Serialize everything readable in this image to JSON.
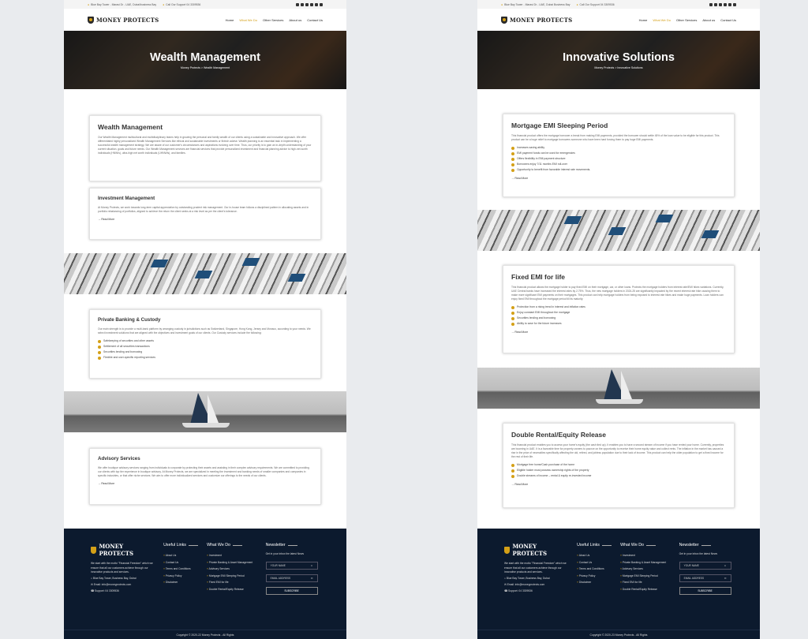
{
  "topbar": {
    "address": "Blue Bay Tower - Marasi Dr - UAE, Dubai/business Bay",
    "phone": "Call Our Support 04 3309536",
    "address_right": "Blue Bay Tower - Marasi Dr - UAE, Dubai Business Bay"
  },
  "brand": "MONEY PROTECTS",
  "nav": [
    "Home",
    "What We Do",
    "Other Services",
    "About us",
    "Contact Us"
  ],
  "left": {
    "hero_title": "Wealth Management",
    "breadcrumb": "Money Protects > Wealth Management",
    "cards": [
      {
        "title": "Wealth Management",
        "body": "Our Wealth Management multicultural and multidisciplinary teams help in growing the personal and family wealth of our clients using a sustainable and innovative approach. We offer differentiated highly personalized Wealth Management Services like ethical and sustainable investments or fintech advise. Wealth planning is an essential task in implementing a successful wealth management strategy. We are aware of our customer's circumstances and aspirations evolving over time. Thus, our priority is to gain an in-depth understanding of your current situation, goals and future needs. Our Wealth Management services are financial services that provide personalized investment and financial planning advice to high-net-worth individuals (HNWIs), ultra-high net worth individuals (UHNWIs), and families."
      },
      {
        "title": "Investment Management",
        "body": "At Money Protects, we work towards long-term capital appreciation by outstanding prudent risk management. Our in-house team follows a disciplined pattern in allocating assets and in portfolio rebalancing of portfolios, aligned to achieve the return the client seeks at a risk level as per the client's tolerance.",
        "readmore": "Read More"
      },
      {
        "title": "Private Banking & Custody",
        "body": "Our main strength is to provide a multi-bank platform by arranging custody in jurisdictions such as Switzerland, Singapore, Hong Kong, Jersey and Monaco, according to your needs. We select investment solutions that are aligned with the objectives and investment goals of our clients. Our Custody services include the following:",
        "items": [
          "Safekeeping of securities and other assets",
          "Settlement of all securities transactions",
          "Securities lending and borrowing",
          "Flexible and user-specific reporting services"
        ]
      },
      {
        "title": "Advisory Services",
        "body": "We offer boutique advisory services ranging from individuals to corporate by protecting their assets and assisting in their complex advisory requirements. We are committed to providing our clients with top tier experience in boutique advisory. At Money Protects, we are specialized in meeting the investment and banking needs of smaller companies and companies in specific industries, or that offer niche services. We aim to offer more individualized services and customize our offerings to the needs of our clients.",
        "readmore": "Read More"
      }
    ]
  },
  "right": {
    "hero_title": "Innovative Solutions",
    "breadcrumb": "Money Protects > Innovative Solutions",
    "cards": [
      {
        "title": "Mortgage EMI Sleeping Period",
        "body": "This financial product offers the mortgage borrower a break from making EMI payments, provided the borrower should settle 45% of the loan value to be eligible for this product. This product can be a huge relief to mortgage borrowers someone who have been hard forcing them to pay huge EMI payments.",
        "items": [
          "Increases saving ability",
          "EMI payment funds can be used for emergencies",
          "Offers flexibility in EMI payment structure",
          "Borrowers enjoy 7/11 months EMI roll-over",
          "Opportunity to benefit from favorable interest rate movements."
        ],
        "readmore": "Read More"
      },
      {
        "title": "Fixed EMI for life",
        "body": "This financial product allows the mortgage holder to pay fixed EMI on their mortgage, car, or other loans. Protects the mortgage holders from interest rate/EMI hikes variations. Currently, UAE Central banks have increased the interest rates by 2.75%. Thus, the new mortgage holders in 2024-25 are significantly impacted by the recent interest rate hike causing them to make more significant EMI payments on their mortgages. This product can help mortgage holders from being exposed to interest rate hikes and make huge payments. Loan holders can enjoy fixed EMI throughout the mortgage period till its maturity.",
        "items": [
          "Protection from a rising trend in interest and inflation rates",
          "Enjoy constant EMI throughout the mortgage",
          "Securities lending and borrowing",
          "Ability to save for the future increases"
        ],
        "readmore": "Read More"
      },
      {
        "title": "Double Rental/Equity Release",
        "body": "This financial product enables you to access your home's equity (the cash tied up). It enables you to have a second stream of income if you have rented your home. Currently, properties are booming in UAE. It is a favorable time for property owners to pounce on the opportunity to receive their home equity value and collect rents. The inflation in the market has caused a rise in the price of necessities specifically affecting the old, retired, and jobless population due to their lack of income. This product can help the older population to get a fixed income for the rest of their life.",
        "items": [
          "Mortgage free home/Cash purchase of the home",
          "Eligible holder must possess ownership rights of the property",
          "Double streams of income – rental & equity re-invested income"
        ],
        "readmore": "Read More"
      }
    ]
  },
  "footer": {
    "about": "We start with the motto \"Financial Freedom\" which we ensure that all our customers achieve through our innovative products and services.",
    "address": "Blue Bay Tower, Business Bay, Dubai",
    "email_label": "Email:",
    "email": "info@moneyprotects.com",
    "support_label": "Support:",
    "support": "04 3309536",
    "useful_title": "Useful Links",
    "useful": [
      "About Us",
      "Contact Us",
      "Terms and Conditions",
      "Privacy Policy",
      "Disclaimer"
    ],
    "whatwedo_title": "What We Do",
    "whatwedo": [
      "Investment",
      "Private Banking & Asset Management",
      "Advisory Services",
      "Mortgage EMI Sleeping Period",
      "Fixed EMI for life",
      "Double Rental/Equity Release"
    ],
    "newsletter_title": "Newsletter",
    "newsletter_text": "Get in your inbox the latest News",
    "name_placeholder": "YOUR NAME",
    "email_placeholder": "EMAIL ADDRESS",
    "subscribe": "SUBSCRIBE",
    "copyright_left": "Copyright © 2020-22 Money Protects - All Rights",
    "copyright_right": "Copyright © 2020-23 Money Protects - All Rights"
  },
  "colors": {
    "accent": "#d4a017",
    "footer_bg": "#0c1a2e"
  }
}
